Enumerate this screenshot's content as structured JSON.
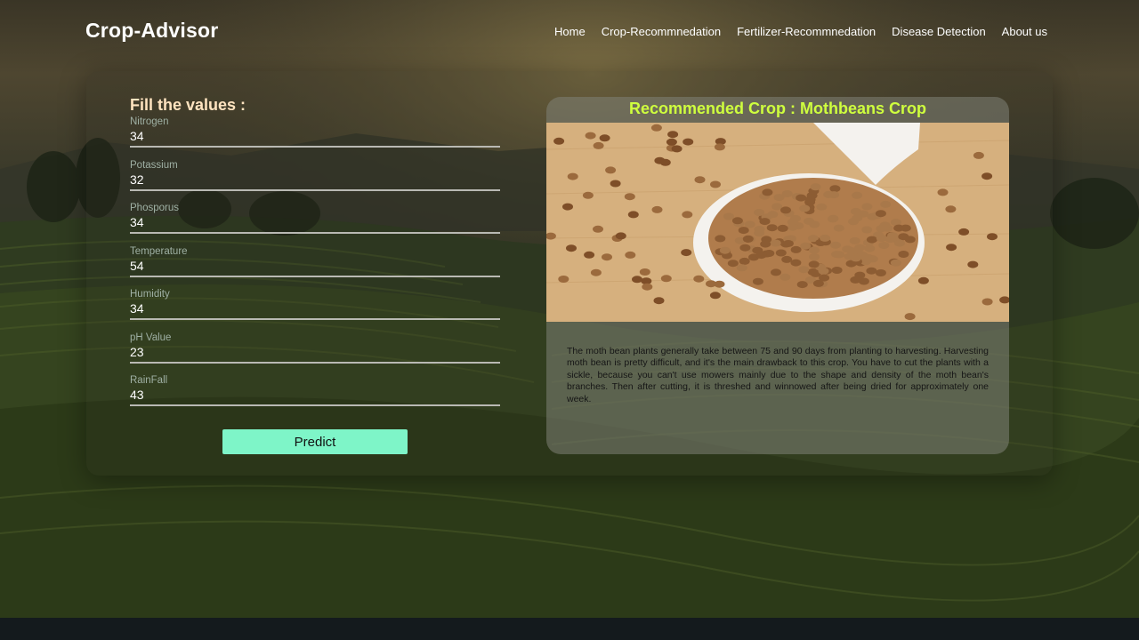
{
  "brand": "Crop-Advisor",
  "nav": [
    "Home",
    "Crop-Recommnedation",
    "Fertilizer-Recommnedation",
    "Disease Detection",
    "About us"
  ],
  "form": {
    "title": "Fill the values :",
    "fields": [
      {
        "label": "Nitrogen",
        "value": "34"
      },
      {
        "label": "Potassium",
        "value": "32"
      },
      {
        "label": "Phosporus",
        "value": "34"
      },
      {
        "label": "Temperature",
        "value": "54"
      },
      {
        "label": "Humidity",
        "value": "34"
      },
      {
        "label": "pH Value",
        "value": "23"
      },
      {
        "label": "RainFall",
        "value": "43"
      }
    ],
    "predict_label": "Predict"
  },
  "result": {
    "title": "Recommended Crop : Mothbeans Crop",
    "description": "The moth bean plants generally take between 75 and 90 days from planting to harvesting. Harvesting moth bean is pretty difficult, and it's the main drawback to this crop. You have to cut the plants with a sickle, because you can't use mowers mainly due to the shape and density of the moth bean's branches. Then after cutting, it is threshed and winnowed after being dried for approximately one week."
  },
  "colors": {
    "accent_title": "#cfff3e",
    "predict_button": "#7ef5c8",
    "form_title": "#ffe4c0"
  }
}
